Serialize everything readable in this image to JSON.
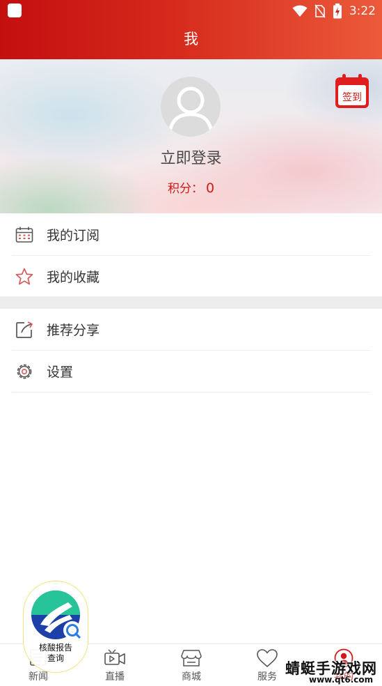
{
  "status_bar": {
    "time": "3:22"
  },
  "header": {
    "title": "我"
  },
  "profile": {
    "login_text": "立即登录",
    "points_label": "积分：",
    "points_value": "0",
    "signin_label": "签到"
  },
  "menu": {
    "group1": [
      {
        "label": "我的订阅",
        "icon": "calendar-icon"
      },
      {
        "label": "我的收藏",
        "icon": "star-icon"
      }
    ],
    "group2": [
      {
        "label": "推荐分享",
        "icon": "share-icon"
      },
      {
        "label": "设置",
        "icon": "gear-icon"
      }
    ]
  },
  "floating_badge": {
    "line1": "核酸报告",
    "line2": "查询"
  },
  "bottom_nav": [
    {
      "label": "新闻",
      "icon": "news-icon"
    },
    {
      "label": "直播",
      "icon": "live-video-icon"
    },
    {
      "label": "商城",
      "icon": "store-icon"
    },
    {
      "label": "服务",
      "icon": "heart-icon"
    },
    {
      "label": "我的",
      "icon": "user-icon",
      "active": true
    }
  ],
  "watermark": {
    "title": "蜻蜓手游戏网",
    "url": "www.qt6.com"
  },
  "colors": {
    "brand_red": "#d21818",
    "header_gradient_start": "#c40f0f",
    "header_gradient_end": "#ec5a3a"
  }
}
